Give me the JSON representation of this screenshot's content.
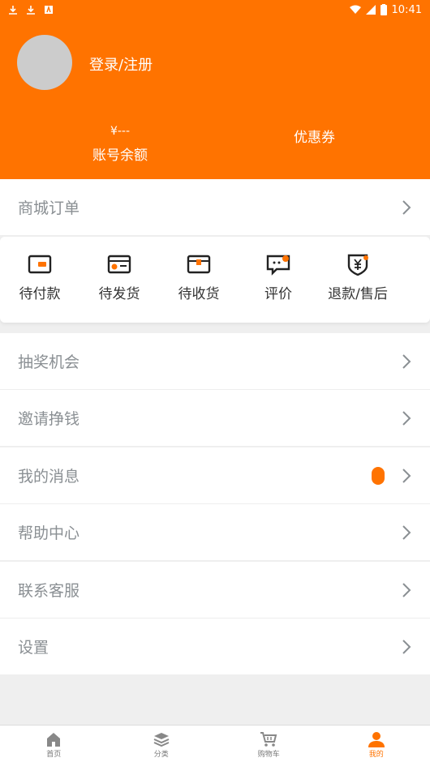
{
  "status_bar": {
    "time": "10:41"
  },
  "profile": {
    "login_text": "登录/注册"
  },
  "balance": {
    "amount": "¥---",
    "label": "账号余额"
  },
  "coupon": {
    "label": "优惠券"
  },
  "orders": {
    "title": "商城订单",
    "items": [
      {
        "label": "待付款",
        "icon": "wallet-icon"
      },
      {
        "label": "待发货",
        "icon": "shipping-card-icon"
      },
      {
        "label": "待收货",
        "icon": "package-box-icon"
      },
      {
        "label": "评价",
        "icon": "comment-icon"
      },
      {
        "label": "退款/售后",
        "icon": "refund-shield-icon"
      }
    ]
  },
  "menu": [
    {
      "label": "抽奖机会"
    },
    {
      "label": "邀请挣钱"
    },
    {
      "label": "我的消息"
    },
    {
      "label": "帮助中心"
    },
    {
      "label": "联系客服"
    },
    {
      "label": "设置"
    }
  ],
  "tabs": [
    {
      "label": "首页",
      "icon": "home-icon"
    },
    {
      "label": "分类",
      "icon": "layers-icon"
    },
    {
      "label": "购物车",
      "icon": "cart-icon"
    },
    {
      "label": "我的",
      "icon": "user-icon"
    }
  ],
  "colors": {
    "accent": "#ff7300",
    "avatar": "#cccccc"
  }
}
